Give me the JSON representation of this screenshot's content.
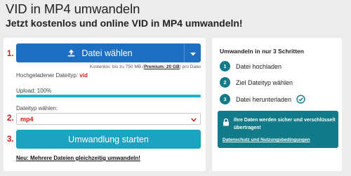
{
  "page": {
    "title": "VID in MP4 umwandeln",
    "subtitle": "Jetzt kostenlos und online VID in MP4 umwandeln!"
  },
  "converter": {
    "step_markers": [
      "1.",
      "2.",
      "3."
    ],
    "upload_button_label": "Datei wählen",
    "size_note_prefix": "Kostenlos: bis zu 750 MB (",
    "size_note_premium": "Premium: 20 GB",
    "size_note_suffix": ") pro Datei",
    "detected_label": "Hochgeladener Dateityp:",
    "detected_value": "vid",
    "progress_label": "Upload: 100%",
    "progress_value": 100,
    "select_label": "Dateityp wählen:",
    "select_value": "mp4",
    "convert_button_label": "Umwandlung starten",
    "multi_link": "Neu: Mehrere Dateien gleichzeitig umwandeln!"
  },
  "steps_panel": {
    "title": "Umwandeln in nur 3 Schritten",
    "steps": [
      {
        "num": "1",
        "label": "Datei hochladen"
      },
      {
        "num": "2",
        "label": "Ziel Dateityp wählen"
      },
      {
        "num": "3",
        "label": "Datei herunterladen"
      }
    ],
    "secure_text": "Ihre Daten werden sicher und verschlüsselt übertragen!",
    "secure_link": "Datenschutz und Nutzungsbedingungen"
  },
  "colors": {
    "primary_blue": "#1e6fc1",
    "convert_teal": "#1ea2c2",
    "accent_red": "#d51818",
    "dark_teal": "#127a88"
  }
}
